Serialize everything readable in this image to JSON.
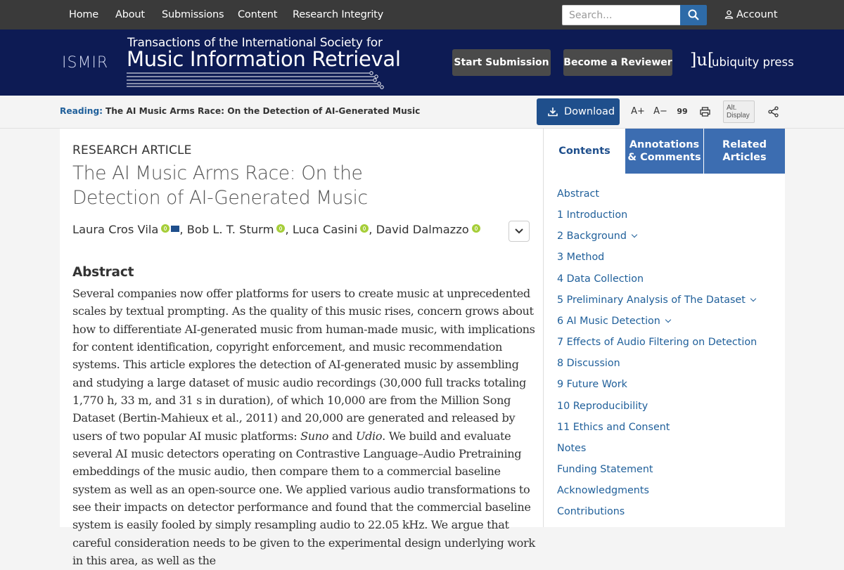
{
  "topnav": {
    "items": [
      "Home",
      "About",
      "Submissions",
      "Content",
      "Research Integrity"
    ],
    "search_placeholder": "Search...",
    "account": "Account"
  },
  "header": {
    "society_logo": "ISMIR",
    "journal_line1": "Transactions of the International Society for",
    "journal_line2": "Music Information Retrieval",
    "start_submission": "Start Submission",
    "become_reviewer": "Become a Reviewer",
    "publisher_mark": "]u[",
    "publisher_name": "ubiquity press"
  },
  "readbar": {
    "reading_label": "Reading:",
    "reading_title": "The AI Music Arms Race: On the Detection of AI-Generated Music",
    "download": "Download",
    "font_larger": "A+",
    "font_smaller": "A−",
    "cite": "99",
    "alt_display_line1": "Alt.",
    "alt_display_line2": "Display"
  },
  "article": {
    "type": "RESEARCH ARTICLE",
    "title_line1": "The AI Music Arms Race: On the",
    "title_line2": "Detection of AI-Generated Music",
    "authors": [
      "Laura Cros Vila",
      "Bob L. T. Sturm",
      "Luca Casini",
      "David Dalmazzo"
    ],
    "separator": ",",
    "abstract_heading": "Abstract",
    "abstract_part1": "Several companies now offer platforms for users to create music at unprecedented scales by textual prompting. As the quality of this music rises, concern grows about how to differentiate AI-generated music from human-made music, with implications for content identification, copyright enforcement, and music recommendation systems. This article explores the detection of AI-generated music by assembling and studying a large dataset of music audio recordings (30,000 full tracks totaling 1,770 h, 33 m, and 31 s in duration), of which 10,000 are from the Million Song Dataset (Bertin-Mahieux et al., 2011) and 20,000 are generated and released by users of two popular AI music platforms: ",
    "abstract_suno": "Suno",
    "abstract_and": " and ",
    "abstract_udio": "Udio",
    "abstract_part2": ". We build and evaluate several AI music detectors operating on Contrastive Language–Audio Pretraining embeddings of the music audio, then compare them to a commercial baseline system as well as an open-source one. We applied various audio transformations to see their impacts on detector performance and found that the commercial baseline system is easily fooled by simply resampling audio to 22.05 kHz. We argue that careful consideration needs to be given to the experimental design underlying work in this area, as well as the"
  },
  "sidebar": {
    "tabs": [
      "Contents",
      "Annotations & Comments",
      "Related Articles"
    ],
    "tab2_line1": "Annotations",
    "tab2_line2": "& Comments",
    "tab3_line1": "Related",
    "tab3_line2": "Articles",
    "toc": [
      {
        "label": "Abstract",
        "expandable": false
      },
      {
        "label": "1 Introduction",
        "expandable": false
      },
      {
        "label": "2 Background",
        "expandable": true
      },
      {
        "label": "3 Method",
        "expandable": false
      },
      {
        "label": "4 Data Collection",
        "expandable": false
      },
      {
        "label": "5 Preliminary Analysis of The Dataset",
        "expandable": true
      },
      {
        "label": "6 AI Music Detection",
        "expandable": true
      },
      {
        "label": "7 Effects of Audio Filtering on Detection",
        "expandable": false
      },
      {
        "label": "8 Discussion",
        "expandable": false
      },
      {
        "label": "9 Future Work",
        "expandable": false
      },
      {
        "label": "10 Reproducibility",
        "expandable": false
      },
      {
        "label": "11 Ethics and Consent",
        "expandable": false
      },
      {
        "label": "Notes",
        "expandable": false
      },
      {
        "label": "Funding Statement",
        "expandable": false
      },
      {
        "label": "Acknowledgments",
        "expandable": false
      },
      {
        "label": "Contributions",
        "expandable": false
      }
    ]
  },
  "colors": {
    "header_bg": "#0d1b54",
    "topnav_bg": "#3a3a3a",
    "accent": "#1f4f8c",
    "link": "#1f5f9a",
    "tab_inactive": "#3c6db1",
    "orcid": "#a6ce39"
  }
}
